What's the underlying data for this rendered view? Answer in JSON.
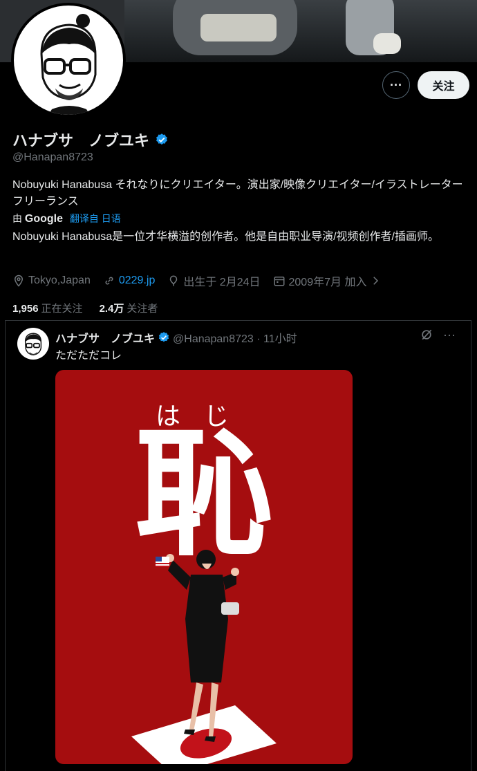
{
  "profile": {
    "display_name": "ハナブサ　ノブユキ",
    "handle": "@Hanapan8723",
    "follow_label": "关注",
    "more_label": "···",
    "bio": "Nobuyuki Hanabusa それなりにクリエイター。演出家/映像クリエイター/イラストレーター フリーランス",
    "translated_by_prefix": "由",
    "translated_by_brand": "Google",
    "translate_label": "翻译自 日语",
    "bio_translation": "Nobuyuki Hanabusa是一位才华横溢的创作者。他是自由职业导演/视频创作者/插画师。",
    "location": "Tokyo,Japan",
    "website": "0229.jp",
    "birthday": "出生于 2月24日",
    "joined": "2009年7月 加入",
    "following_count": "1,956",
    "following_label": "正在关注",
    "followers_count": "2.4万",
    "followers_label": "关注者"
  },
  "tweet": {
    "author_name": "ハナブサ　ノブユキ",
    "author_handle": "@Hanapan8723 · 11小时",
    "text": "ただただコレ",
    "image": {
      "ruby_text": "はじ",
      "main_kanji": "恥"
    }
  },
  "colors": {
    "background": "#000000",
    "accent": "#1d9bf0",
    "muted": "#71767b",
    "poster_red": "#a50d0f"
  },
  "icons": [
    "more-icon",
    "verified-badge-icon",
    "location-icon",
    "link-icon",
    "birthday-icon",
    "calendar-icon",
    "chevron-right-icon",
    "grok-icon"
  ]
}
